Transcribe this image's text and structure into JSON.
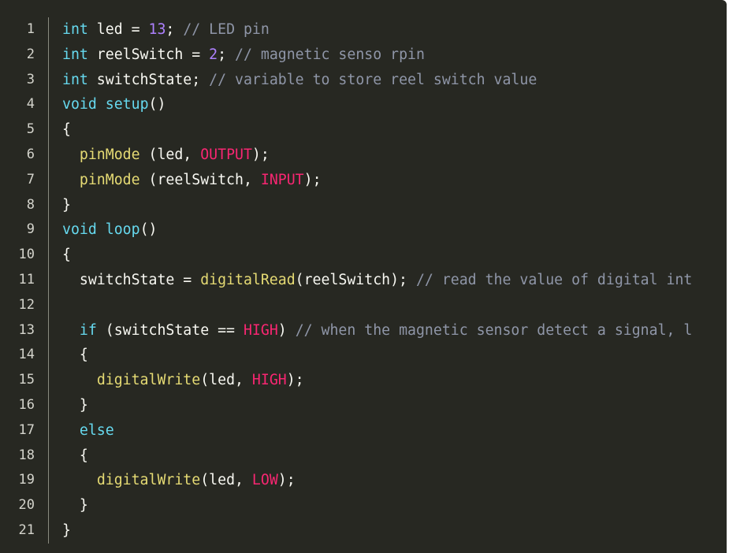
{
  "colors": {
    "background": "#272822",
    "keyword": "#66d9ef",
    "function": "#e6db74",
    "constant": "#f92672",
    "number": "#ae81ff",
    "comment": "#8f96a8",
    "text": "#f8f8f2"
  },
  "lines": [
    {
      "n": "1",
      "tokens": [
        {
          "t": "kw",
          "v": "int"
        },
        {
          "t": "p",
          "v": " led = "
        },
        {
          "t": "num",
          "v": "13"
        },
        {
          "t": "p",
          "v": "; "
        },
        {
          "t": "cm",
          "v": "// LED pin"
        }
      ]
    },
    {
      "n": "2",
      "tokens": [
        {
          "t": "kw",
          "v": "int"
        },
        {
          "t": "p",
          "v": " reelSwitch = "
        },
        {
          "t": "num",
          "v": "2"
        },
        {
          "t": "p",
          "v": "; "
        },
        {
          "t": "cm",
          "v": "// magnetic senso rpin"
        }
      ]
    },
    {
      "n": "3",
      "tokens": [
        {
          "t": "kw",
          "v": "int"
        },
        {
          "t": "p",
          "v": " switchState; "
        },
        {
          "t": "cm",
          "v": "// variable to store reel switch value"
        }
      ]
    },
    {
      "n": "4",
      "tokens": [
        {
          "t": "kw",
          "v": "void"
        },
        {
          "t": "p",
          "v": " "
        },
        {
          "t": "kw",
          "v": "setup"
        },
        {
          "t": "p",
          "v": "()"
        }
      ]
    },
    {
      "n": "5",
      "tokens": [
        {
          "t": "p",
          "v": "{"
        }
      ]
    },
    {
      "n": "6",
      "tokens": [
        {
          "t": "p",
          "v": "  "
        },
        {
          "t": "fn",
          "v": "pinMode"
        },
        {
          "t": "p",
          "v": " (led, "
        },
        {
          "t": "const",
          "v": "OUTPUT"
        },
        {
          "t": "p",
          "v": ");"
        }
      ]
    },
    {
      "n": "7",
      "tokens": [
        {
          "t": "p",
          "v": "  "
        },
        {
          "t": "fn",
          "v": "pinMode"
        },
        {
          "t": "p",
          "v": " (reelSwitch, "
        },
        {
          "t": "const",
          "v": "INPUT"
        },
        {
          "t": "p",
          "v": ");"
        }
      ]
    },
    {
      "n": "8",
      "tokens": [
        {
          "t": "p",
          "v": "}"
        }
      ]
    },
    {
      "n": "9",
      "tokens": [
        {
          "t": "kw",
          "v": "void"
        },
        {
          "t": "p",
          "v": " "
        },
        {
          "t": "kw",
          "v": "loop"
        },
        {
          "t": "p",
          "v": "()"
        }
      ]
    },
    {
      "n": "10",
      "tokens": [
        {
          "t": "p",
          "v": "{"
        }
      ]
    },
    {
      "n": "11",
      "tokens": [
        {
          "t": "p",
          "v": "  switchState = "
        },
        {
          "t": "fn",
          "v": "digitalRead"
        },
        {
          "t": "p",
          "v": "(reelSwitch); "
        },
        {
          "t": "cm",
          "v": "// read the value of digital int"
        }
      ]
    },
    {
      "n": "12",
      "tokens": []
    },
    {
      "n": "13",
      "tokens": [
        {
          "t": "p",
          "v": "  "
        },
        {
          "t": "kw",
          "v": "if"
        },
        {
          "t": "p",
          "v": " (switchState == "
        },
        {
          "t": "const",
          "v": "HIGH"
        },
        {
          "t": "p",
          "v": ") "
        },
        {
          "t": "cm",
          "v": "// when the magnetic sensor detect a signal, l"
        }
      ]
    },
    {
      "n": "14",
      "tokens": [
        {
          "t": "p",
          "v": "  {"
        }
      ]
    },
    {
      "n": "15",
      "tokens": [
        {
          "t": "p",
          "v": "    "
        },
        {
          "t": "fn",
          "v": "digitalWrite"
        },
        {
          "t": "p",
          "v": "(led, "
        },
        {
          "t": "const",
          "v": "HIGH"
        },
        {
          "t": "p",
          "v": ");"
        }
      ]
    },
    {
      "n": "16",
      "tokens": [
        {
          "t": "p",
          "v": "  }"
        }
      ]
    },
    {
      "n": "17",
      "tokens": [
        {
          "t": "p",
          "v": "  "
        },
        {
          "t": "kw",
          "v": "else"
        }
      ]
    },
    {
      "n": "18",
      "tokens": [
        {
          "t": "p",
          "v": "  {"
        }
      ]
    },
    {
      "n": "19",
      "tokens": [
        {
          "t": "p",
          "v": "    "
        },
        {
          "t": "fn",
          "v": "digitalWrite"
        },
        {
          "t": "p",
          "v": "(led, "
        },
        {
          "t": "const",
          "v": "LOW"
        },
        {
          "t": "p",
          "v": ");"
        }
      ]
    },
    {
      "n": "20",
      "tokens": [
        {
          "t": "p",
          "v": "  }"
        }
      ]
    },
    {
      "n": "21",
      "tokens": [
        {
          "t": "p",
          "v": "}"
        }
      ]
    }
  ]
}
